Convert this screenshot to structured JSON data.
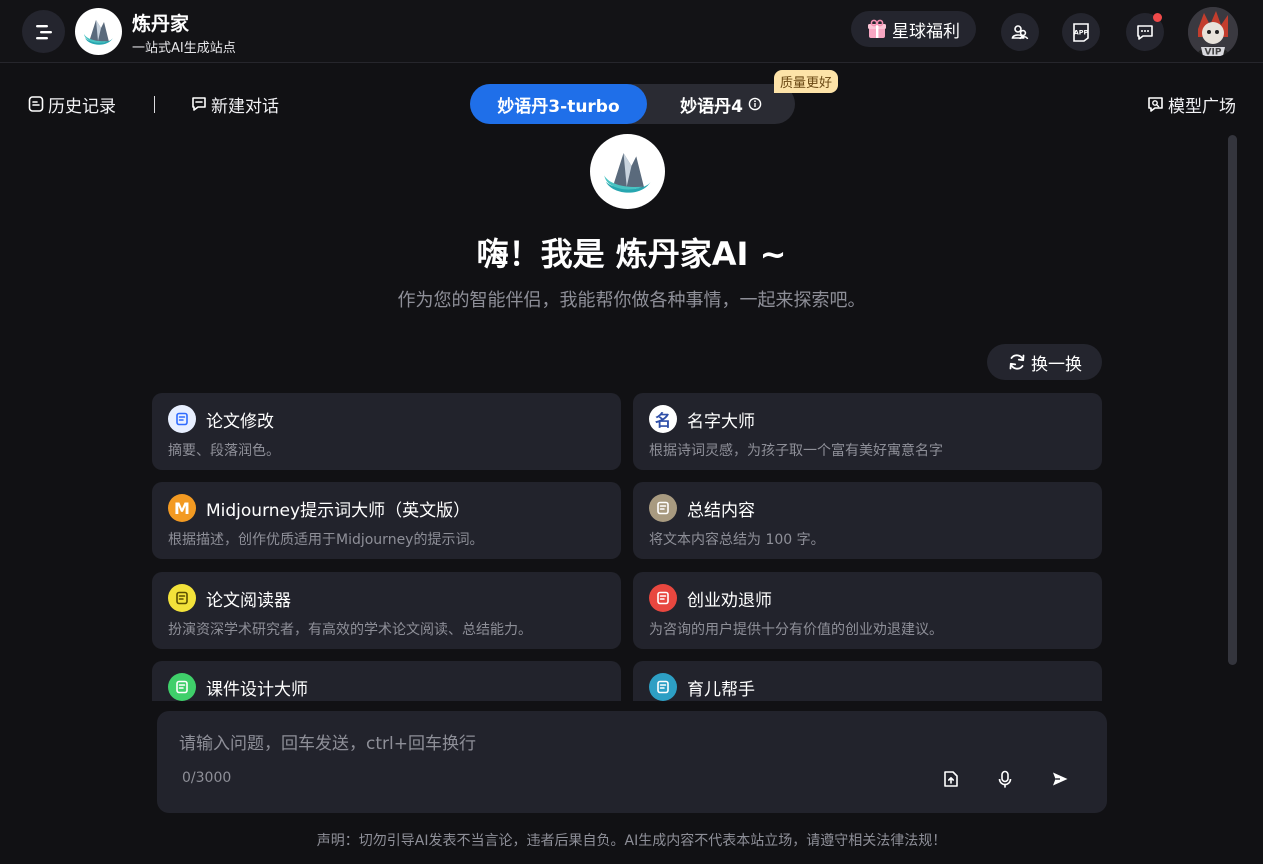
{
  "header": {
    "brand_name": "炼丹家",
    "brand_subtitle": "一站式AI生成站点",
    "welfare_label": "星球福利",
    "app_icon_label": "APP"
  },
  "toolbar": {
    "history_label": "历史记录",
    "new_chat_label": "新建对话",
    "model_plaza_label": "模型广场"
  },
  "model_switch": {
    "active_label": "妙语丹3-turbo",
    "other_label": "妙语丹4",
    "badge": "质量更好"
  },
  "hero": {
    "title": "嗨！我是 炼丹家AI ~",
    "subtitle": "作为您的智能伴侣，我能帮你做各种事情，一起来探索吧。"
  },
  "refresh_label": "换一换",
  "cards": [
    {
      "title": "论文修改",
      "desc": "摘要、段落润色。",
      "icon": "edit-document-icon",
      "icon_bg": "#e8efff",
      "icon_color": "#2f6bff"
    },
    {
      "title": "名字大师",
      "desc": "根据诗词灵感，为孩子取一个富有美好寓意名字",
      "icon": "name-seal-icon",
      "icon_bg": "#ffffff",
      "icon_color": "#2f4fa8",
      "icon_text": "名"
    },
    {
      "title": "Midjourney提示词大师（英文版）",
      "desc": "根据描述，创作优质适用于Midjourney的提示词。",
      "icon": "midjourney-icon",
      "icon_bg": "#f39a22",
      "icon_color": "#ffffff",
      "icon_text": "M"
    },
    {
      "title": "总结内容",
      "desc": "将文本内容总结为 100 字。",
      "icon": "summary-note-icon",
      "icon_bg": "#a89a80",
      "icon_color": "#ffffff"
    },
    {
      "title": "论文阅读器",
      "desc": "扮演资深学术研究者，有高效的学术论文阅读、总结能力。",
      "icon": "reader-icon",
      "icon_bg": "#f3e23a",
      "icon_color": "#5a4e00"
    },
    {
      "title": "创业劝退师",
      "desc": "为咨询的用户提供十分有价值的创业劝退建议。",
      "icon": "stop-hand-icon",
      "icon_bg": "#e8473f",
      "icon_color": "#ffffff"
    },
    {
      "title": "课件设计大师",
      "desc": "",
      "icon": "courseware-icon",
      "icon_bg": "#3fcf6a",
      "icon_color": "#ffffff"
    },
    {
      "title": "育儿帮手",
      "desc": "",
      "icon": "parenting-icon",
      "icon_bg": "#2d9fc4",
      "icon_color": "#ffffff"
    }
  ],
  "input": {
    "placeholder": "请输入问题，回车发送，ctrl+回车换行",
    "char_count": "0/3000"
  },
  "disclaimer": "声明：切勿引导AI发表不当言论，违者后果自负。AI生成内容不代表本站立场，请遵守相关法律法规！",
  "colors": {
    "accent": "#1f6fe9",
    "background": "#111114",
    "card": "#22232c",
    "notification": "#f04a4a",
    "badge": "#fde3a8"
  }
}
